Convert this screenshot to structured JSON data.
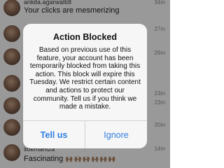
{
  "comments": [
    {
      "username": "ankita.agarwal68",
      "text": "Your clicks are mesmerizing",
      "time": "34m"
    },
    {
      "time": "27m"
    },
    {
      "time": "26m"
    },
    {
      "time": "23m"
    },
    {
      "time": "23m"
    },
    {
      "time": "20m"
    },
    {
      "username": "soemaritza",
      "text": "Fascinating",
      "emoji": "🙌🏽🙌🏽🙌🏽🙌🏽🙌🏽🙌🏽",
      "time": "14m"
    }
  ],
  "alert": {
    "title": "Action Blocked",
    "message": "Based on previous use of this feature, your account has been temporarily blocked from taking this action. This block will expire this Tuesday. We restrict certain content and actions to protect our community. Tell us if you think we made a mistake.",
    "buttons": {
      "tell_us": "Tell us",
      "ignore": "Ignore"
    }
  },
  "colors": {
    "button_text": "#2f7de1",
    "dialog_bg": "#f6f6f6"
  }
}
